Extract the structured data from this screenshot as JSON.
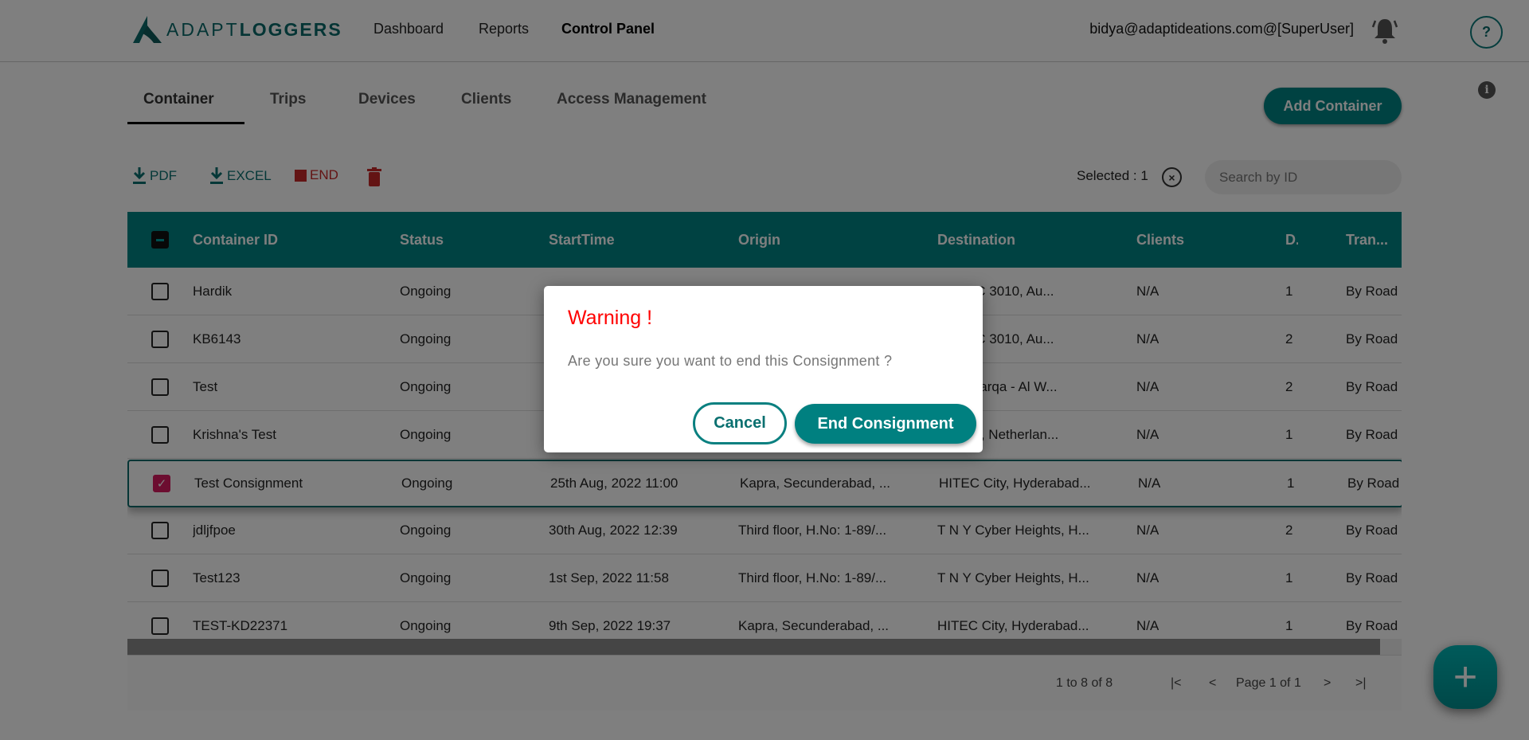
{
  "brand": {
    "logo_light": "ADAPT",
    "logo_bold": "LOGGERS"
  },
  "nav": {
    "items": [
      "Dashboard",
      "Reports",
      "Control Panel"
    ],
    "active": "Control Panel"
  },
  "user": {
    "email": "bidya@adaptideations.com@[SuperUser]"
  },
  "help_label": "?",
  "info_label": "i",
  "tabs": [
    "Container",
    "Trips",
    "Devices",
    "Clients",
    "Access Management"
  ],
  "add_container": "Add Container",
  "toolbar": {
    "pdf": "PDF",
    "excel": "EXCEL",
    "end": "END"
  },
  "selection": {
    "label": "Selected : 1",
    "clear": "×"
  },
  "search": {
    "placeholder": "Search by ID"
  },
  "columns": [
    "Container ID",
    "Status",
    "StartTime",
    "Origin",
    "Destination",
    "Clients",
    "D.",
    "Tran..."
  ],
  "rows": [
    {
      "id": "Hardik",
      "status": "Ongoing",
      "start": "",
      "origin": "",
      "dest": "e VIC 3010, Au...",
      "clients": "N/A",
      "d": "1",
      "trans": "By Road",
      "checked": false
    },
    {
      "id": "KB6143",
      "status": "Ongoing",
      "start": "",
      "origin": "",
      "dest": "e VIC 3010, Au...",
      "clients": "N/A",
      "d": "2",
      "trans": "By Road",
      "checked": false
    },
    {
      "id": "Test",
      "status": "Ongoing",
      "start": "",
      "origin": "",
      "dest": "Al Warqa - Al W...",
      "clients": "N/A",
      "d": "2",
      "trans": "By Road",
      "checked": false
    },
    {
      "id": "Krishna's Test",
      "status": "Ongoing",
      "start": "",
      "origin": "",
      "dest": "ersel, Netherlan...",
      "clients": "N/A",
      "d": "1",
      "trans": "By Road",
      "checked": false
    },
    {
      "id": "Test Consignment",
      "status": "Ongoing",
      "start": "25th Aug, 2022 11:00",
      "origin": "Kapra, Secunderabad, ...",
      "dest": "HITEC City, Hyderabad...",
      "clients": "N/A",
      "d": "1",
      "trans": "By Road",
      "checked": true
    },
    {
      "id": "jdljfpoe",
      "status": "Ongoing",
      "start": "30th Aug, 2022 12:39",
      "origin": "Third floor, H.No: 1-89/...",
      "dest": "T N Y Cyber Heights, H...",
      "clients": "N/A",
      "d": "2",
      "trans": "By Road",
      "checked": false
    },
    {
      "id": "Test123",
      "status": "Ongoing",
      "start": "1st Sep, 2022 11:58",
      "origin": "Third floor, H.No: 1-89/...",
      "dest": "T N Y Cyber Heights, H...",
      "clients": "N/A",
      "d": "1",
      "trans": "By Road",
      "checked": false
    },
    {
      "id": "TEST-KD22371",
      "status": "Ongoing",
      "start": "9th Sep, 2022 19:37",
      "origin": "Kapra, Secunderabad, ...",
      "dest": "HITEC City, Hyderabad...",
      "clients": "N/A",
      "d": "1",
      "trans": "By Road",
      "checked": false
    }
  ],
  "pagination": {
    "range": "1 to 8 of 8",
    "page": "Page 1 of 1",
    "first": "|<",
    "prev": "<",
    "next": ">",
    "last": ">|"
  },
  "fab": "+",
  "modal": {
    "title": "Warning !",
    "message": "Are you sure you want to end this Consignment ?",
    "cancel": "Cancel",
    "confirm": "End Consignment"
  },
  "colors": {
    "teal": "#008484",
    "warning": "#ff0000",
    "checkbox": "#d81b60",
    "end": "#c62828"
  }
}
